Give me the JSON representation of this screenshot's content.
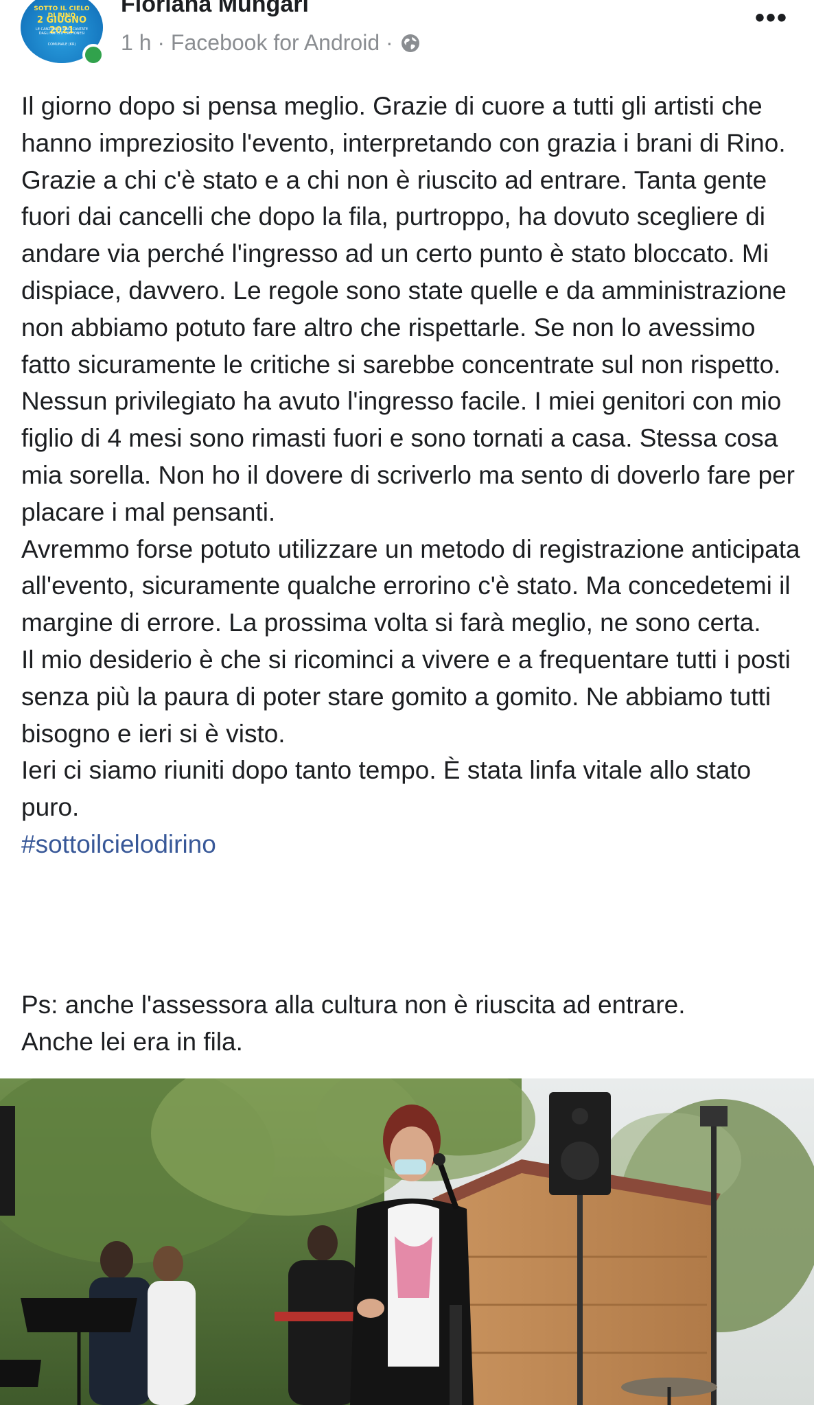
{
  "post": {
    "author_name": "Floriana Mungari",
    "meta_text": "1 h · Facebook for Android ·",
    "privacy_icon": "globe-icon",
    "more_label": "•••",
    "avatar": {
      "line1": "SOTTO IL CIELO DI RINO",
      "line2": "2 GIUGNO 2021",
      "line3": "LE CANZONI DI RINO CANTATE DAGLI ARTISTI CROTONESI",
      "line4": "COMUNALE (KR)"
    },
    "paragraphs": [
      "Il giorno dopo si pensa meglio. Grazie di cuore a tutti gli artisti che hanno impreziosito l'evento, interpretando con grazia i brani di Rino.",
      "Grazie a chi c'è stato e a chi non è riuscito ad entrare. Tanta gente fuori dai cancelli che dopo la fila, purtroppo, ha dovuto scegliere di andare via perché l'ingresso ad un certo punto è stato bloccato. Mi dispiace, davvero. Le regole sono state quelle e da amministrazione non abbiamo potuto fare altro che rispettarle. Se non lo avessimo fatto sicuramente le critiche si sarebbe concentrate sul non rispetto.",
      "Nessun privilegiato ha avuto l'ingresso facile. I miei genitori con mio figlio di 4 mesi sono rimasti fuori e sono tornati a casa. Stessa cosa mia sorella. Non ho il dovere di scriverlo ma sento di doverlo fare per placare i mal pensanti.",
      "Avremmo forse potuto utilizzare un metodo di registrazione anticipata all'evento, sicuramente qualche errorino c'è stato. Ma concedetemi il margine di errore. La prossima volta si farà meglio, ne sono certa.",
      "Il mio desiderio è che si ricominci a vivere e a frequentare tutti i posti senza più la paura di poter stare gomito a gomito. Ne abbiamo tutti bisogno e ieri si è visto.",
      "Ieri ci siamo riuniti dopo tanto tempo. È stata linfa vitale allo stato puro."
    ],
    "hashtag": "#sottoilcielodirino",
    "ps_lines": [
      "Ps: anche l'assessora alla cultura non è riuscita ad entrare.",
      "Anche lei era in fila."
    ]
  },
  "colors": {
    "text": "#1c1e21",
    "meta": "#8a8d91",
    "hashtag": "#385898",
    "online": "#31a24c"
  }
}
